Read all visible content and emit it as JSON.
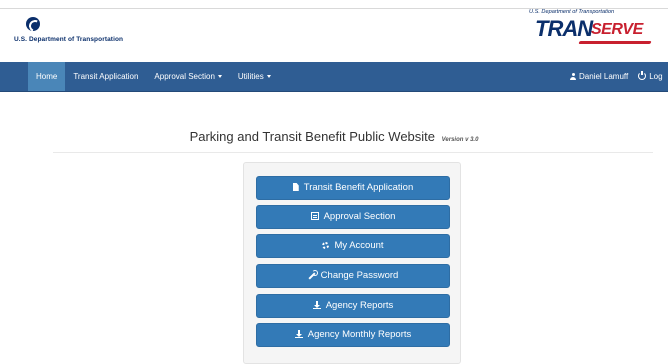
{
  "header": {
    "dot_title": "U.S. Department of Transportation",
    "transerve_subtitle": "U.S. Department of Transportation",
    "transerve_tran": "TRAN",
    "transerve_serve": "SERVE"
  },
  "nav": {
    "items": [
      {
        "label": "Home",
        "active": true
      },
      {
        "label": "Transit Application",
        "active": false
      },
      {
        "label": "Approval Section",
        "active": false,
        "dropdown": true
      },
      {
        "label": "Utilities",
        "active": false,
        "dropdown": true
      }
    ],
    "user": "Daniel Lamuff",
    "logout": "Log"
  },
  "main": {
    "title": "Parking and Transit Benefit Public Website",
    "version": "Version v 3.0",
    "buttons": [
      {
        "label": "Transit Benefit Application",
        "icon": "file-icon"
      },
      {
        "label": "Approval Section",
        "icon": "list-icon"
      },
      {
        "label": "My Account",
        "icon": "cog-icon"
      },
      {
        "label": "Change Password",
        "icon": "wrench-icon"
      },
      {
        "label": "Agency Reports",
        "icon": "download-icon"
      },
      {
        "label": "Agency Monthly Reports",
        "icon": "download-icon"
      }
    ]
  },
  "colors": {
    "navbar": "#2f5d93",
    "nav_active": "#4a86b8",
    "button": "#337ab7",
    "brand_red": "#c8202f",
    "brand_navy": "#0b2f6b"
  }
}
